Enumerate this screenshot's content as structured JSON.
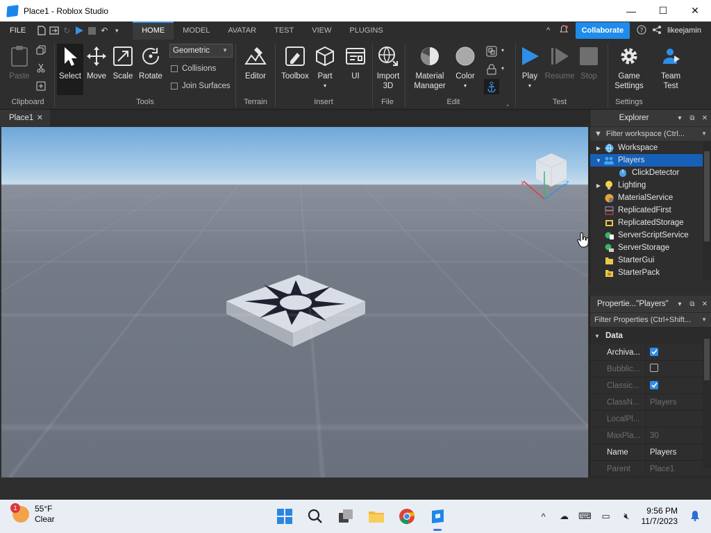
{
  "window": {
    "title": "Place1 - Roblox Studio",
    "controls": {
      "minimize": "—",
      "maximize": "☐",
      "close": "✕"
    }
  },
  "menubar": {
    "file": "FILE",
    "tabs": [
      "HOME",
      "MODEL",
      "AVATAR",
      "TEST",
      "VIEW",
      "PLUGINS"
    ],
    "active_tab": "HOME",
    "collaborate": "Collaborate",
    "username": "likeejamin"
  },
  "ribbon": {
    "clipboard": {
      "paste": "Paste",
      "group": "Clipboard"
    },
    "tools": {
      "select": "Select",
      "move": "Move",
      "scale": "Scale",
      "rotate": "Rotate",
      "group": "Tools",
      "mode": "Geometric",
      "collisions": "Collisions",
      "join_surfaces": "Join Surfaces"
    },
    "terrain": {
      "editor": "Editor",
      "group": "Terrain"
    },
    "insert": {
      "toolbox": "Toolbox",
      "part": "Part",
      "ui": "UI",
      "group": "Insert"
    },
    "file": {
      "import": "Import\n3D",
      "import_l1": "Import",
      "import_l2": "3D",
      "group": "File"
    },
    "edit": {
      "material_l1": "Material",
      "material_l2": "Manager",
      "color": "Color",
      "group": "Edit"
    },
    "test": {
      "play": "Play",
      "resume": "Resume",
      "stop": "Stop",
      "group": "Test"
    },
    "settings": {
      "game_l1": "Game",
      "game_l2": "Settings",
      "team_l1": "Team",
      "team_l2": "Test",
      "group": "Settings"
    }
  },
  "doc_tab": {
    "label": "Place1"
  },
  "explorer": {
    "title": "Explorer",
    "filter_placeholder": "Filter workspace (Ctrl...",
    "items": [
      {
        "label": "Workspace",
        "expand": "▶",
        "icon": "globe-icon",
        "color": "#4aa3e8",
        "indent": 0
      },
      {
        "label": "Players",
        "expand": "▼",
        "icon": "players-icon",
        "color": "#4aa3e8",
        "indent": 0,
        "selected": true
      },
      {
        "label": "ClickDetector",
        "expand": "",
        "icon": "mouse-icon",
        "color": "#4aa3e8",
        "indent": 1
      },
      {
        "label": "Lighting",
        "expand": "▶",
        "icon": "lightbulb-icon",
        "color": "#f5d24a",
        "indent": 0
      },
      {
        "label": "MaterialService",
        "expand": "",
        "icon": "material-icon",
        "color": "#e8a33a",
        "indent": 0
      },
      {
        "label": "ReplicatedFirst",
        "expand": "",
        "icon": "replicated-first-icon",
        "color": "#8fa3c8",
        "indent": 0
      },
      {
        "label": "ReplicatedStorage",
        "expand": "",
        "icon": "replicated-storage-icon",
        "color": "#e8c84a",
        "indent": 0
      },
      {
        "label": "ServerScriptService",
        "expand": "",
        "icon": "script-service-icon",
        "color": "#3ab46a",
        "indent": 0
      },
      {
        "label": "ServerStorage",
        "expand": "",
        "icon": "server-storage-icon",
        "color": "#3ab46a",
        "indent": 0
      },
      {
        "label": "StarterGui",
        "expand": "",
        "icon": "starter-gui-icon",
        "color": "#e8c84a",
        "indent": 0
      },
      {
        "label": "StarterPack",
        "expand": "",
        "icon": "starter-pack-icon",
        "color": "#e8c84a",
        "indent": 0
      }
    ]
  },
  "properties": {
    "title": "Propertie...\"Players\"",
    "filter_placeholder": "Filter Properties (Ctrl+Shift...",
    "section": "Data",
    "rows": [
      {
        "name": "Archiva...",
        "value": "",
        "type": "checked",
        "dim": false
      },
      {
        "name": "Bubblic...",
        "value": "",
        "type": "unchecked",
        "dim": true
      },
      {
        "name": "Classic...",
        "value": "",
        "type": "checked",
        "dim": true
      },
      {
        "name": "ClassN...",
        "value": "Players",
        "type": "text",
        "dim": true
      },
      {
        "name": "LocalPl...",
        "value": "",
        "type": "text",
        "dim": true
      },
      {
        "name": "MaxPla...",
        "value": "30",
        "type": "text",
        "dim": true
      },
      {
        "name": "Name",
        "value": "Players",
        "type": "text",
        "dim": false
      },
      {
        "name": "Parent",
        "value": "Place1",
        "type": "text",
        "dim": true
      }
    ]
  },
  "taskbar": {
    "weather_temp": "55°F",
    "weather_desc": "Clear",
    "weather_badge": "1",
    "time": "9:56 PM",
    "date": "11/7/2023"
  },
  "colors": {
    "accent": "#1f8bea",
    "selection": "#1660b8",
    "panel_bg": "#2e2e2e"
  }
}
